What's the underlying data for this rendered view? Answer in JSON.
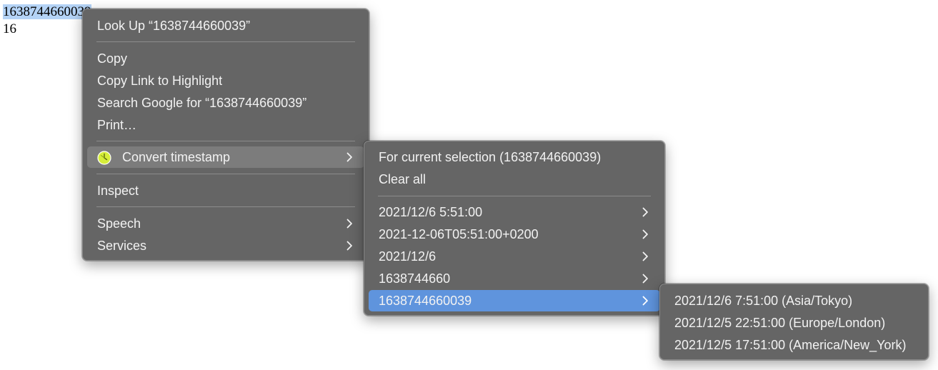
{
  "page": {
    "selected_number": "1638744660039",
    "second_line": "16"
  },
  "context_menu": {
    "look_up": "Look Up “1638744660039”",
    "copy": "Copy",
    "copy_link": "Copy Link to Highlight",
    "search_google": "Search Google for “1638744660039”",
    "print": "Print…",
    "convert_timestamp": "Convert timestamp",
    "inspect": "Inspect",
    "speech": "Speech",
    "services": "Services"
  },
  "convert_submenu": {
    "for_current_selection": "For current selection (1638744660039)",
    "clear_all": "Clear all",
    "items": [
      "2021/12/6 5:51:00",
      "2021-12-06T05:51:00+0200",
      "2021/12/6",
      "1638744660",
      "1638744660039"
    ]
  },
  "timezone_submenu": {
    "items": [
      "2021/12/6 7:51:00 (Asia/Tokyo)",
      "2021/12/5 22:51:00 (Europe/London)",
      "2021/12/5 17:51:00 (America/New_York)"
    ]
  },
  "icons": {
    "extension": "clock-extension-icon",
    "submenu": "chevron-right-icon"
  },
  "colors": {
    "menu_background": "#656565",
    "hover_item": "#7c7c7c",
    "active_item": "#5f94dd",
    "text_selection": "#b4d3f6",
    "extension_icon": "#d6ee3a"
  }
}
